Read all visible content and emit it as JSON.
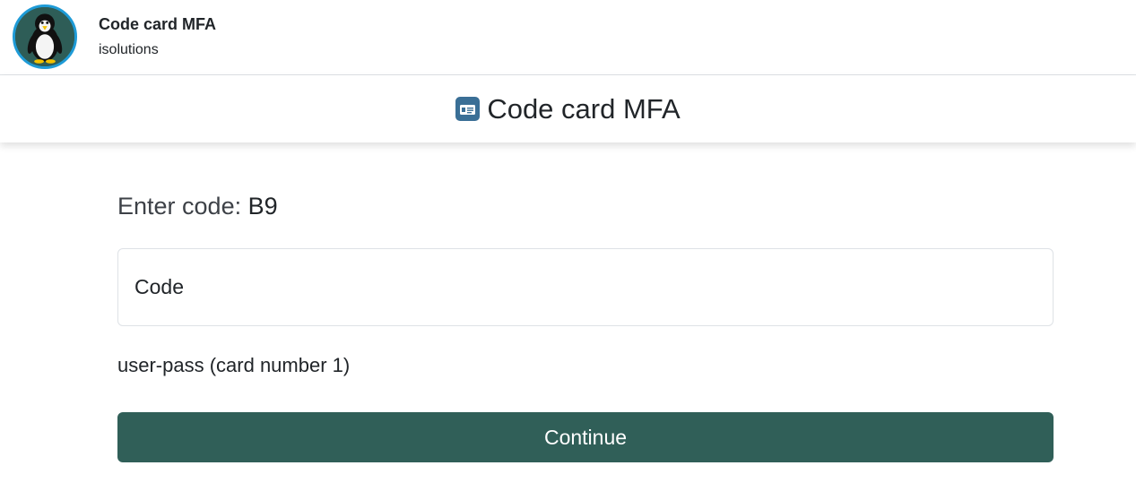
{
  "header": {
    "app_title": "Code card MFA",
    "app_subtitle": "isolutions",
    "avatar_icon": "penguin-icon"
  },
  "page": {
    "title": "Code card MFA",
    "title_icon": "id-card-icon",
    "title_icon_color": "#3a6f96"
  },
  "form": {
    "prompt_label": "Enter code:",
    "prompt_code": "B9",
    "code_input": {
      "placeholder": "Code",
      "value": ""
    },
    "card_info": "user-pass (card number 1)",
    "continue_label": "Continue"
  },
  "colors": {
    "accent": "#305f58",
    "avatar_border": "#1e9bd7",
    "avatar_background": "#2e5d57"
  }
}
